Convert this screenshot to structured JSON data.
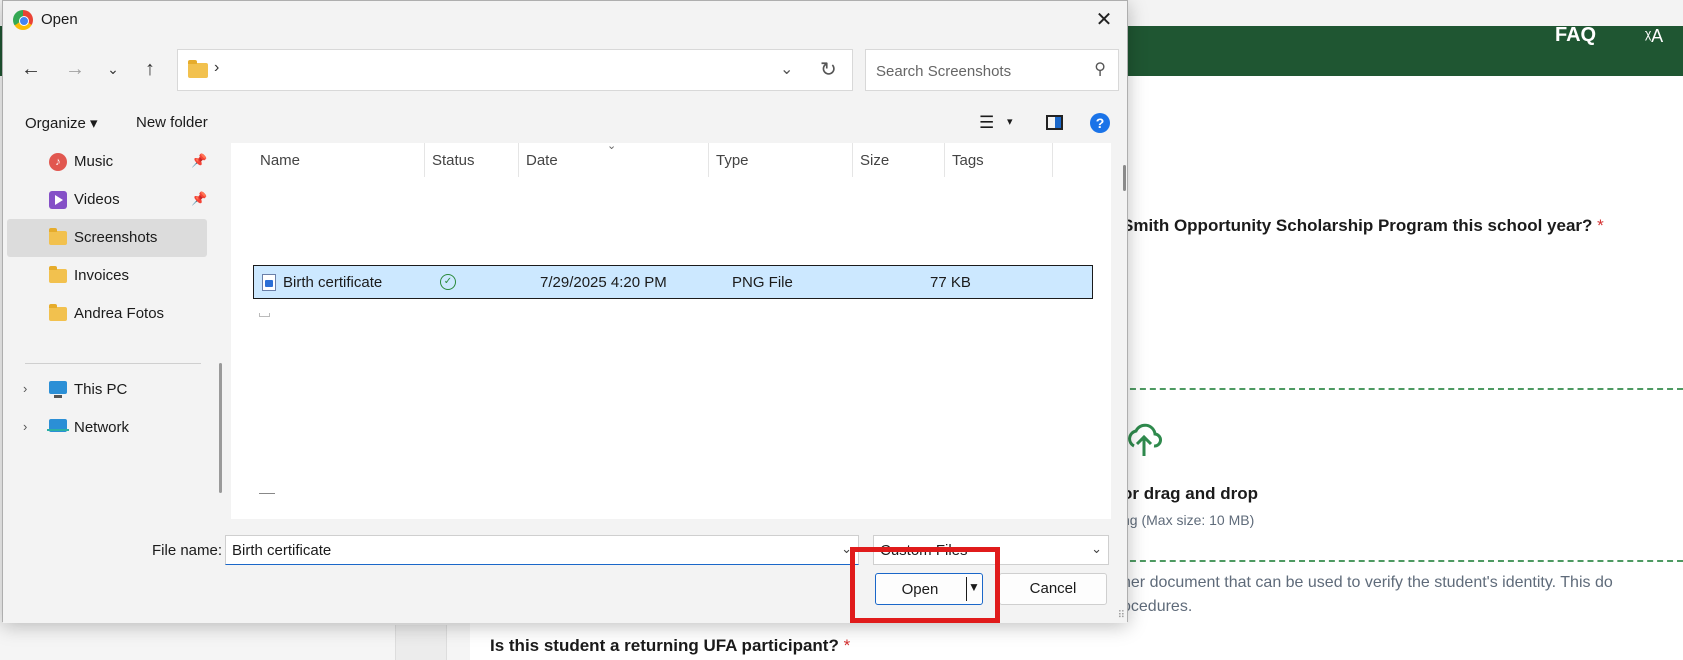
{
  "background": {
    "faq": "FAQ",
    "translate_glyph": "ᵡA",
    "question1": "Smith Opportunity Scholarship Program this school year?",
    "required_mark": "*",
    "upload_text": "or drag and drop",
    "max_size": "ng (Max size: 10 MB)",
    "doc_line1": "her document that can be used to verify the student's identity. This do",
    "doc_line2": "ocedures.",
    "question2": "Is this student a returning UFA participant?",
    "colors": {
      "header": "#1f5632",
      "dash": "#4e9a62",
      "required": "#d32f2f"
    }
  },
  "dialog": {
    "title": "Open",
    "close_glyph": "✕",
    "nav": {
      "back": "←",
      "forward": "→",
      "recent": "⌄",
      "up": "↑"
    },
    "address": {
      "chevron": "›",
      "dropdown": "⌄",
      "refresh": "↻"
    },
    "search": {
      "placeholder": "Search Screenshots",
      "icon": "⚲"
    },
    "commands": {
      "organize": "Organize ▾",
      "new_folder": "New folder",
      "view_icon": "☰",
      "view_drop": "▾",
      "help": "?"
    },
    "sidebar": [
      {
        "label": "Music",
        "icon": "music-icon",
        "pinned": true
      },
      {
        "label": "Videos",
        "icon": "video-icon",
        "pinned": true
      },
      {
        "label": "Screenshots",
        "icon": "folder-icon",
        "selected": true
      },
      {
        "label": "Invoices",
        "icon": "folder-icon"
      },
      {
        "label": "Andrea Fotos",
        "icon": "folder-icon"
      },
      {
        "label": "This PC",
        "icon": "pc-icon",
        "expandable": true
      },
      {
        "label": "Network",
        "icon": "network-icon",
        "expandable": true
      }
    ],
    "pin_glyph": "📌",
    "expand_glyph": "›",
    "columns": [
      "Name",
      "Status",
      "Date",
      "Type",
      "Size",
      "Tags"
    ],
    "sort_glyph": "⌄",
    "files": [
      {
        "name": "Birth certificate",
        "status": "✓",
        "date": "7/29/2025 4:20 PM",
        "type": "PNG File",
        "size": "77 KB",
        "selected": true
      }
    ],
    "file_name_label": "File name:",
    "file_name_value": "Birth certificate",
    "file_type": "Custom Files",
    "open_label": "Open",
    "cancel_label": "Cancel",
    "dropdown_glyph": "⌄",
    "open_drop_glyph": "▼",
    "grip_glyph": "⠿",
    "highlight_color": "#e01b1b"
  }
}
